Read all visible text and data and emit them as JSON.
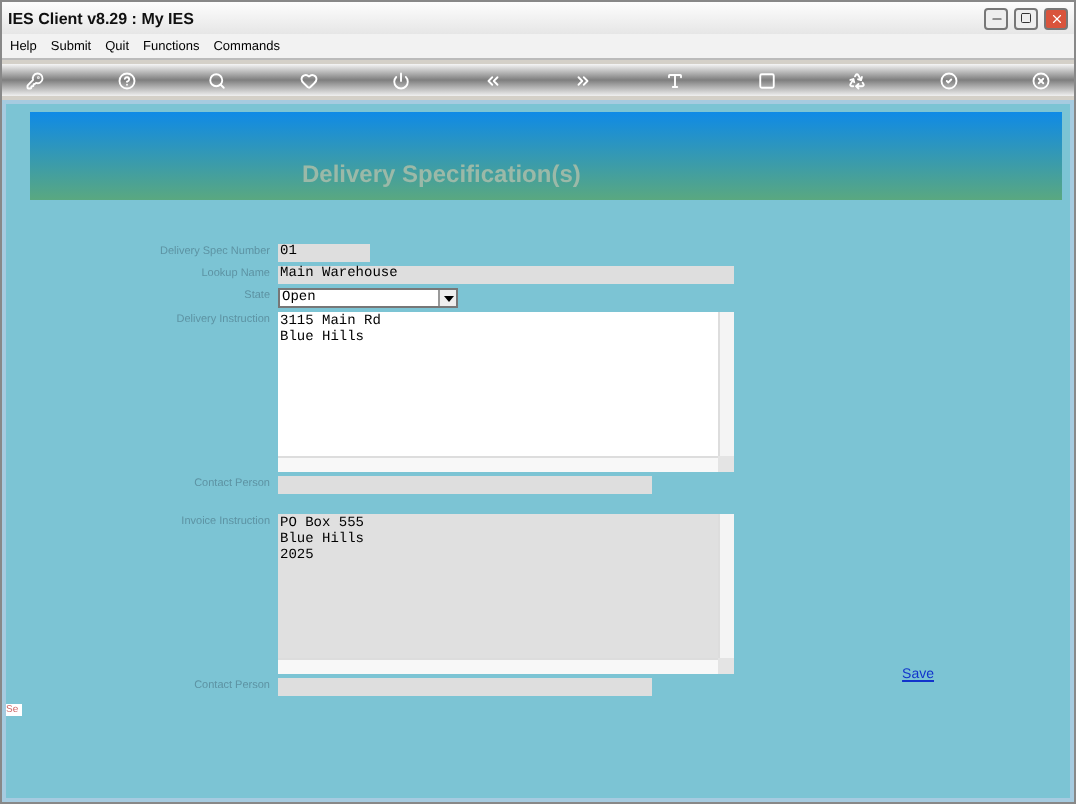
{
  "window": {
    "title": "IES Client v8.29 : My IES"
  },
  "menu": [
    "Help",
    "Submit",
    "Quit",
    "Functions",
    "Commands"
  ],
  "header": {
    "title": "Delivery Specification(s)"
  },
  "form": [
    {
      "kind": "number",
      "label": "Delivery Spec Number",
      "value": "01"
    },
    {
      "kind": "name",
      "label": "Lookup Name",
      "value": "Main Warehouse"
    },
    {
      "kind": "select",
      "label": "State",
      "value": "Open"
    },
    {
      "kind": "area",
      "label": "Delivery Instruction",
      "lines": [
        "3115 Main Rd",
        "Blue Hills"
      ],
      "disabled": false
    },
    {
      "kind": "contact",
      "label": "Contact Person"
    },
    {
      "kind": "gap"
    },
    {
      "kind": "area",
      "label": "Invoice Instruction",
      "lines": [
        "PO Box 555",
        "Blue Hills",
        "2025"
      ],
      "disabled": true
    },
    {
      "kind": "contact",
      "label": "Contact Person"
    }
  ],
  "save_link": "Save",
  "side_tab": "Se"
}
